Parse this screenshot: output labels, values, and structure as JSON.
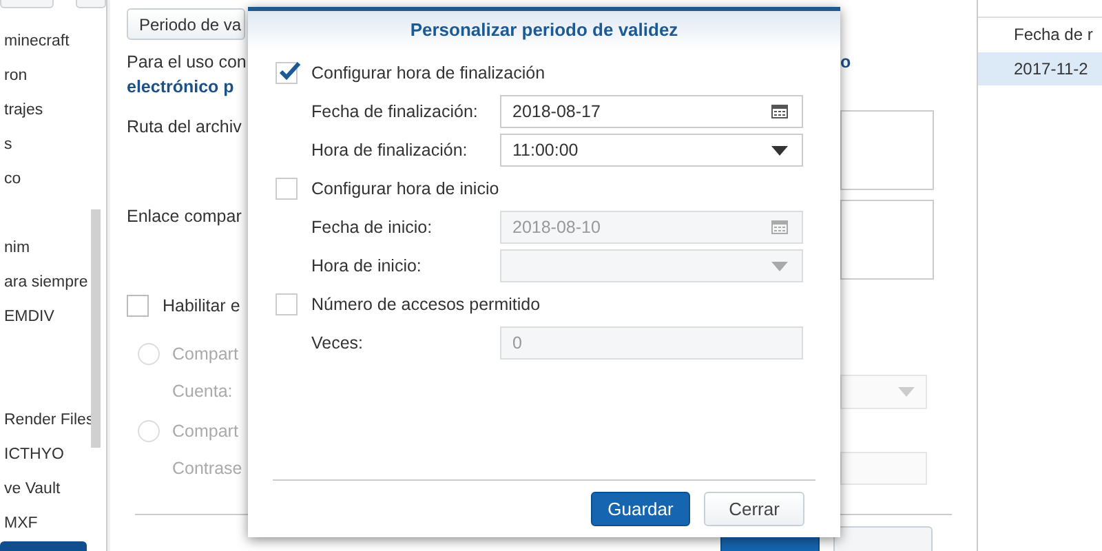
{
  "sidebar": {
    "tabs": [
      {
        "selected": false
      },
      {
        "selected": false
      }
    ],
    "items": [
      {
        "label": "minecraft",
        "selected": false
      },
      {
        "label": "ron",
        "selected": false
      },
      {
        "label": "trajes",
        "selected": false
      },
      {
        "label": "s",
        "selected": false
      },
      {
        "label": "co",
        "selected": false
      },
      {
        "selected": false
      },
      {
        "label": "nim",
        "selected": false
      },
      {
        "label": "ara siempre",
        "selected": false
      },
      {
        "label": "EMDIV",
        "selected": false
      },
      {
        "selected": false
      },
      {
        "selected": false
      },
      {
        "label": "Render Files",
        "selected": false
      },
      {
        "label": "ICTHYO",
        "selected": false
      },
      {
        "label": "ve Vault",
        "selected": false
      },
      {
        "label": "MXF",
        "selected": false
      },
      {
        "selected": true
      }
    ]
  },
  "main": {
    "tab": "Periodo de va",
    "description_start": "Para el uso con",
    "description_link": "electrónico p",
    "description_end": "o",
    "path_label": "Ruta del archiv",
    "link_label": "Enlace compar",
    "enable": {
      "label": "Habilitar e",
      "checked": false
    },
    "options": [
      {
        "label": "Compart",
        "selected": false,
        "field_label": "Cuenta:"
      },
      {
        "label": "Compart",
        "selected": false,
        "field_label": "Contrase"
      }
    ],
    "buttons": [
      {
        "kind": "primary"
      },
      {
        "kind": "secondary"
      }
    ]
  },
  "right_panel": {
    "column": "Fecha de r",
    "rows": [
      {
        "cell": "2017-11-2",
        "selected": true
      }
    ]
  },
  "dialog": {
    "title": "Personalizar periodo de validez",
    "rows": [
      {
        "kind": "checkbox",
        "label": "Configurar hora de finalización",
        "checked": true
      },
      {
        "kind": "date",
        "label": "Fecha de finalización:",
        "value": "2018-08-17",
        "disabled": false
      },
      {
        "kind": "select",
        "label": "Hora de finalización:",
        "value": "11:00:00",
        "disabled": false
      },
      {
        "kind": "checkbox",
        "label": "Configurar hora de inicio",
        "checked": false
      },
      {
        "kind": "date",
        "label": "Fecha de inicio:",
        "value": "2018-08-10",
        "disabled": true
      },
      {
        "kind": "select",
        "label": "Hora de inicio:",
        "disabled": true
      },
      {
        "kind": "checkbox",
        "label": "Número de accesos permitido",
        "checked": false
      },
      {
        "kind": "text",
        "label": "Veces:",
        "value": "0",
        "disabled": true
      }
    ],
    "buttons": [
      {
        "label": "Guardar",
        "kind": "primary"
      },
      {
        "label": "Cerrar",
        "kind": "secondary"
      }
    ]
  }
}
